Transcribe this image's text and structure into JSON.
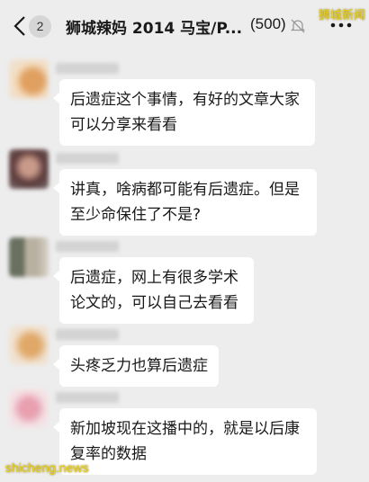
{
  "header": {
    "unread_count": "2",
    "title": "狮城辣妈 2014 马宝/P...",
    "member_count": "(500)",
    "back_icon": "chevron-left-icon",
    "mute_icon": "mute-bell-icon",
    "more_icon": "more-dots-icon"
  },
  "watermarks": {
    "top": "狮城新闻",
    "bottom": "shicheng.news"
  },
  "messages": [
    {
      "text": "后遗症这个事情，有好的文章大家可以分享来看看"
    },
    {
      "text": "讲真，啥病都可能有后遗症。但是至少命保住了不是?"
    },
    {
      "text": "后遗症，网上有很多学术论文的，可以自己去看看"
    },
    {
      "text": "头疼乏力也算后遗症"
    },
    {
      "text": "新加坡现在这播中的，就是以后康复率的数据"
    }
  ],
  "colors": {
    "background": "#ededed",
    "bubble": "#ffffff",
    "watermark": "#f0d200"
  }
}
